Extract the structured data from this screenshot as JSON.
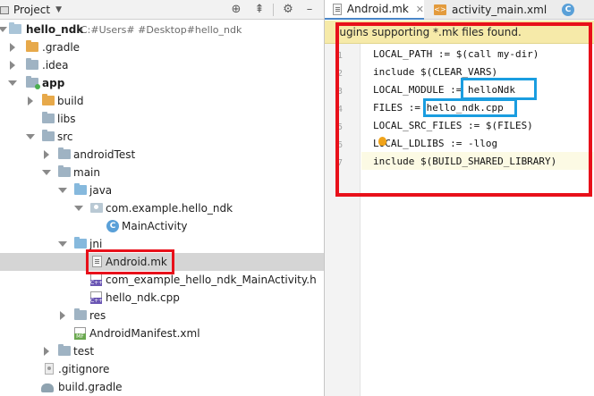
{
  "project_panel": {
    "title": "Project",
    "toolbar_icons": [
      "target-icon",
      "collapse-icon",
      "gear-icon",
      "hide-icon"
    ],
    "tree": [
      {
        "id": "root",
        "label": "hello_ndk",
        "path": "C:#Users#          #Desktop#hello_ndk",
        "bold": true
      },
      {
        "id": "gradle-folder",
        "label": ".gradle"
      },
      {
        "id": "idea-folder",
        "label": ".idea"
      },
      {
        "id": "app-folder",
        "label": "app",
        "bold": true
      },
      {
        "id": "build-folder",
        "label": "build"
      },
      {
        "id": "libs-folder",
        "label": "libs"
      },
      {
        "id": "src-folder",
        "label": "src"
      },
      {
        "id": "androidtest-folder",
        "label": "androidTest"
      },
      {
        "id": "main-folder",
        "label": "main"
      },
      {
        "id": "java-folder",
        "label": "java"
      },
      {
        "id": "package",
        "label": "com.example.hello_ndk"
      },
      {
        "id": "mainactivity",
        "label": "MainActivity"
      },
      {
        "id": "jni-folder",
        "label": "jni"
      },
      {
        "id": "android-mk",
        "label": "Android.mk"
      },
      {
        "id": "header-file",
        "label": "com_example_hello_ndk_MainActivity.h"
      },
      {
        "id": "cpp-file",
        "label": "hello_ndk.cpp"
      },
      {
        "id": "res-folder",
        "label": "res"
      },
      {
        "id": "manifest",
        "label": "AndroidManifest.xml"
      },
      {
        "id": "test-folder",
        "label": "test"
      },
      {
        "id": "gitignore",
        "label": ".gitignore"
      },
      {
        "id": "build-gradle",
        "label": "build.gradle"
      }
    ]
  },
  "editor": {
    "tabs": [
      {
        "label": "Android.mk",
        "active": true
      },
      {
        "label": "activity_main.xml",
        "active": false
      },
      {
        "label": "",
        "active": false
      }
    ],
    "file_icon_letters": {
      "cpp": "C++",
      "manifest": "MF",
      "class": "C",
      "xml": "<>"
    },
    "banner": "lugins supporting *.mk files found.",
    "lines": [
      {
        "number": "1",
        "text": "LOCAL_PATH := $(call my-dir)"
      },
      {
        "number": "2",
        "text": "include $(CLEAR_VARS)"
      },
      {
        "number": "3",
        "text": "LOCAL_MODULE := helloNdk"
      },
      {
        "number": "4",
        "text": "FILES := hello_ndk.cpp"
      },
      {
        "number": "5",
        "text": "LOCAL_SRC_FILES := $(FILES)"
      },
      {
        "number": "6",
        "text": "LOCAL_LDLIBS := -llog"
      },
      {
        "number": "7",
        "text": "include $(BUILD_SHARED_LIBRARY)"
      }
    ]
  },
  "annotations": {
    "red": "#e8101a",
    "blue": "#1a9de0"
  },
  "colors": {
    "selection": "#d5d5d5",
    "banner": "#f6eaa9",
    "folder_orange": "#e7a94a",
    "folder_blue": "#86b9dd"
  }
}
